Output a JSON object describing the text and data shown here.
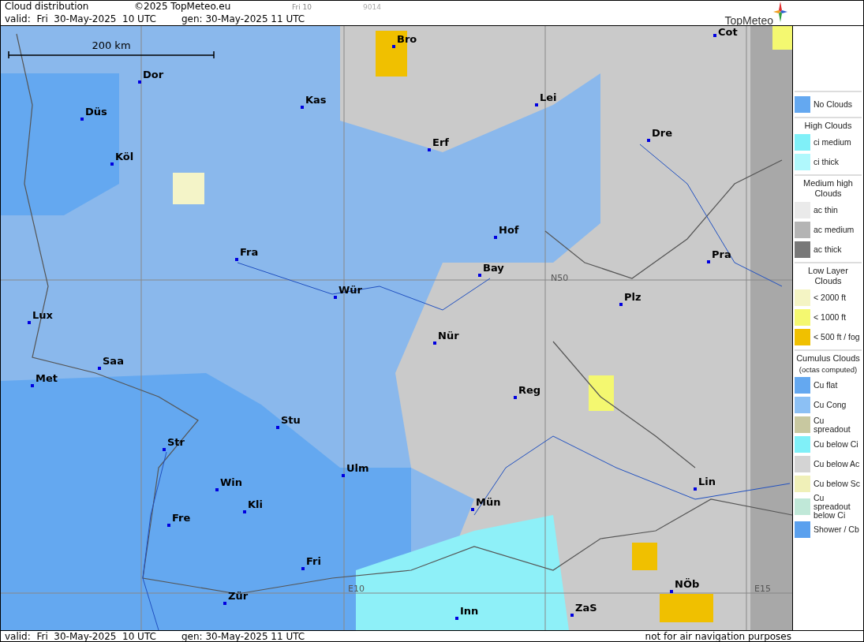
{
  "header": {
    "title": "Cloud distribution",
    "copyright": "©2025 TopMeteo.eu",
    "run_label": "Fri 10",
    "code": "9014",
    "valid": "valid:  Fri  30-May-2025  10 UTC",
    "generated": "gen: 30-May-2025 11 UTC",
    "logo": "TopMeteo"
  },
  "map": {
    "scale_label": "200 km",
    "grid_labels": [
      "N50",
      "E10",
      "E15"
    ],
    "cities": [
      "Bro",
      "Cot",
      "Dor",
      "Kas",
      "Lei",
      "Düs",
      "Erf",
      "Dre",
      "Köl",
      "Hof",
      "Fra",
      "Pra",
      "Bay",
      "Wür",
      "Plz",
      "Lux",
      "Nür",
      "Saa",
      "Met",
      "Reg",
      "Stu",
      "Str",
      "Ulm",
      "Win",
      "Lin",
      "Kli",
      "Mün",
      "Fre",
      "Fri",
      "NÖb",
      "Zür",
      "ZaS",
      "Inn"
    ]
  },
  "legend": [
    {
      "items": [
        {
          "label": "No Clouds",
          "color": "#64a8f0"
        }
      ]
    },
    {
      "heading": "High Clouds",
      "items": [
        {
          "label": "ci medium",
          "color": "#80f0f8"
        },
        {
          "label": "ci thick",
          "color": "#b0f8fc"
        }
      ]
    },
    {
      "heading": "Medium high Clouds",
      "items": [
        {
          "label": "ac thin",
          "color": "#eaeaea"
        },
        {
          "label": "ac medium",
          "color": "#b4b4b4"
        },
        {
          "label": "ac thick",
          "color": "#787878"
        }
      ]
    },
    {
      "heading": "Low Layer Clouds",
      "items": [
        {
          "label": "< 2000 ft",
          "color": "#f4f4c4"
        },
        {
          "label": "< 1000 ft",
          "color": "#f4f870"
        },
        {
          "label": "< 500 ft / fog",
          "color": "#f0c000"
        }
      ]
    },
    {
      "heading": "Cumulus Clouds",
      "subheading": "(octas computed)",
      "items": [
        {
          "label": "Cu flat",
          "color": "#64a8f0"
        },
        {
          "label": "Cu Cong",
          "color": "#8cc0f4"
        },
        {
          "label": "Cu spreadout",
          "color": "#c8c8a0"
        },
        {
          "label": "Cu below Ci",
          "color": "#80f0f8"
        },
        {
          "label": "Cu below Ac",
          "color": "#d4d4d4"
        },
        {
          "label": "Cu below Sc",
          "color": "#f0f0b8"
        },
        {
          "label": "Cu spreadout below Ci",
          "color": "#c0e8d8"
        },
        {
          "label": "Shower / Cb",
          "color": "#5aa0ee"
        }
      ]
    }
  ],
  "footer": {
    "valid": "valid:  Fri  30-May-2025  10 UTC",
    "generated": "gen: 30-May-2025 11 UTC",
    "disclaimer": "not for air navigation purposes"
  }
}
